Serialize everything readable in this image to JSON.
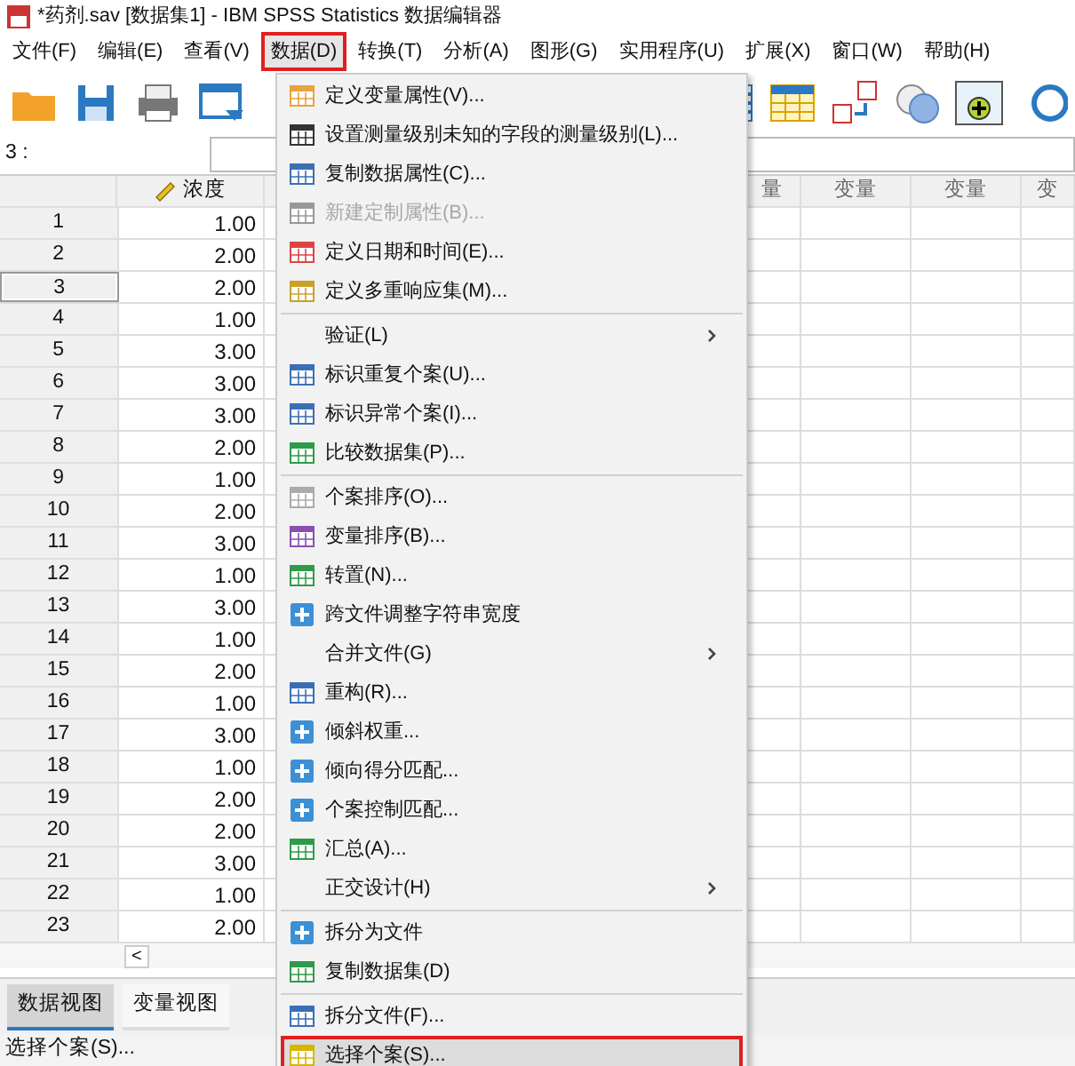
{
  "window": {
    "title": "*药剂.sav [数据集1] - IBM SPSS Statistics 数据编辑器"
  },
  "menubar": [
    {
      "label": "文件(F)",
      "selected": false
    },
    {
      "label": "编辑(E)",
      "selected": false
    },
    {
      "label": "查看(V)",
      "selected": false
    },
    {
      "label": "数据(D)",
      "selected": true
    },
    {
      "label": "转换(T)",
      "selected": false
    },
    {
      "label": "分析(A)",
      "selected": false
    },
    {
      "label": "图形(G)",
      "selected": false
    },
    {
      "label": "实用程序(U)",
      "selected": false
    },
    {
      "label": "扩展(X)",
      "selected": false
    },
    {
      "label": "窗口(W)",
      "selected": false
    },
    {
      "label": "帮助(H)",
      "selected": false
    }
  ],
  "cell_editor": {
    "label": "3 :"
  },
  "grid": {
    "columns": [
      "浓度",
      "",
      "量",
      "变量",
      "变量",
      "变"
    ],
    "rows": [
      {
        "number": "1",
        "value": "1.00",
        "selected": false
      },
      {
        "number": "2",
        "value": "2.00",
        "selected": false
      },
      {
        "number": "3",
        "value": "2.00",
        "selected": true
      },
      {
        "number": "4",
        "value": "1.00",
        "selected": false
      },
      {
        "number": "5",
        "value": "3.00",
        "selected": false
      },
      {
        "number": "6",
        "value": "3.00",
        "selected": false
      },
      {
        "number": "7",
        "value": "3.00",
        "selected": false
      },
      {
        "number": "8",
        "value": "2.00",
        "selected": false
      },
      {
        "number": "9",
        "value": "1.00",
        "selected": false
      },
      {
        "number": "10",
        "value": "2.00",
        "selected": false
      },
      {
        "number": "11",
        "value": "3.00",
        "selected": false
      },
      {
        "number": "12",
        "value": "1.00",
        "selected": false
      },
      {
        "number": "13",
        "value": "3.00",
        "selected": false
      },
      {
        "number": "14",
        "value": "1.00",
        "selected": false
      },
      {
        "number": "15",
        "value": "2.00",
        "selected": false
      },
      {
        "number": "16",
        "value": "1.00",
        "selected": false
      },
      {
        "number": "17",
        "value": "3.00",
        "selected": false
      },
      {
        "number": "18",
        "value": "1.00",
        "selected": false
      },
      {
        "number": "19",
        "value": "2.00",
        "selected": false
      },
      {
        "number": "20",
        "value": "2.00",
        "selected": false
      },
      {
        "number": "21",
        "value": "3.00",
        "selected": false
      },
      {
        "number": "22",
        "value": "1.00",
        "selected": false
      },
      {
        "number": "23",
        "value": "2.00",
        "selected": false
      }
    ],
    "scroll_button": "<"
  },
  "view_tabs": [
    {
      "label": "数据视图",
      "selected": true
    },
    {
      "label": "变量视图",
      "selected": false
    }
  ],
  "status_bar": "选择个案(S)...",
  "menu": {
    "groups": [
      [
        {
          "label": "定义变量属性(V)...",
          "kind": "action",
          "disabled": false,
          "selected": false
        },
        {
          "label": "设置测量级别未知的字段的测量级别(L)...",
          "kind": "action",
          "disabled": false,
          "selected": false
        },
        {
          "label": "复制数据属性(C)...",
          "kind": "action",
          "disabled": false,
          "selected": false
        },
        {
          "label": "新建定制属性(B)...",
          "kind": "action",
          "disabled": true,
          "selected": false
        },
        {
          "label": "定义日期和时间(E)...",
          "kind": "action",
          "disabled": false,
          "selected": false
        },
        {
          "label": "定义多重响应集(M)...",
          "kind": "action",
          "disabled": false,
          "selected": false
        }
      ],
      [
        {
          "label": "验证(L)",
          "kind": "submenu",
          "disabled": false,
          "selected": false
        },
        {
          "label": "标识重复个案(U)...",
          "kind": "action",
          "disabled": false,
          "selected": false
        },
        {
          "label": "标识异常个案(I)...",
          "kind": "action",
          "disabled": false,
          "selected": false
        },
        {
          "label": "比较数据集(P)...",
          "kind": "action",
          "disabled": false,
          "selected": false
        }
      ],
      [
        {
          "label": "个案排序(O)...",
          "kind": "action",
          "disabled": false,
          "selected": false
        },
        {
          "label": "变量排序(B)...",
          "kind": "action",
          "disabled": false,
          "selected": false
        },
        {
          "label": "转置(N)...",
          "kind": "action",
          "disabled": false,
          "selected": false
        },
        {
          "label": "跨文件调整字符串宽度",
          "kind": "action",
          "disabled": false,
          "selected": false
        },
        {
          "label": "合并文件(G)",
          "kind": "submenu",
          "disabled": false,
          "selected": false
        },
        {
          "label": "重构(R)...",
          "kind": "action",
          "disabled": false,
          "selected": false
        },
        {
          "label": "倾斜权重...",
          "kind": "action",
          "disabled": false,
          "selected": false
        },
        {
          "label": "倾向得分匹配...",
          "kind": "action",
          "disabled": false,
          "selected": false
        },
        {
          "label": "个案控制匹配...",
          "kind": "action",
          "disabled": false,
          "selected": false
        },
        {
          "label": "汇总(A)...",
          "kind": "action",
          "disabled": false,
          "selected": false
        },
        {
          "label": "正交设计(H)",
          "kind": "submenu",
          "disabled": false,
          "selected": false
        }
      ],
      [
        {
          "label": "拆分为文件",
          "kind": "action",
          "disabled": false,
          "selected": false
        },
        {
          "label": "复制数据集(D)",
          "kind": "action",
          "disabled": false,
          "selected": false
        }
      ],
      [
        {
          "label": "拆分文件(F)...",
          "kind": "action",
          "disabled": false,
          "selected": false
        },
        {
          "label": "选择个案(S)...",
          "kind": "action",
          "disabled": false,
          "selected": true
        }
      ]
    ]
  }
}
